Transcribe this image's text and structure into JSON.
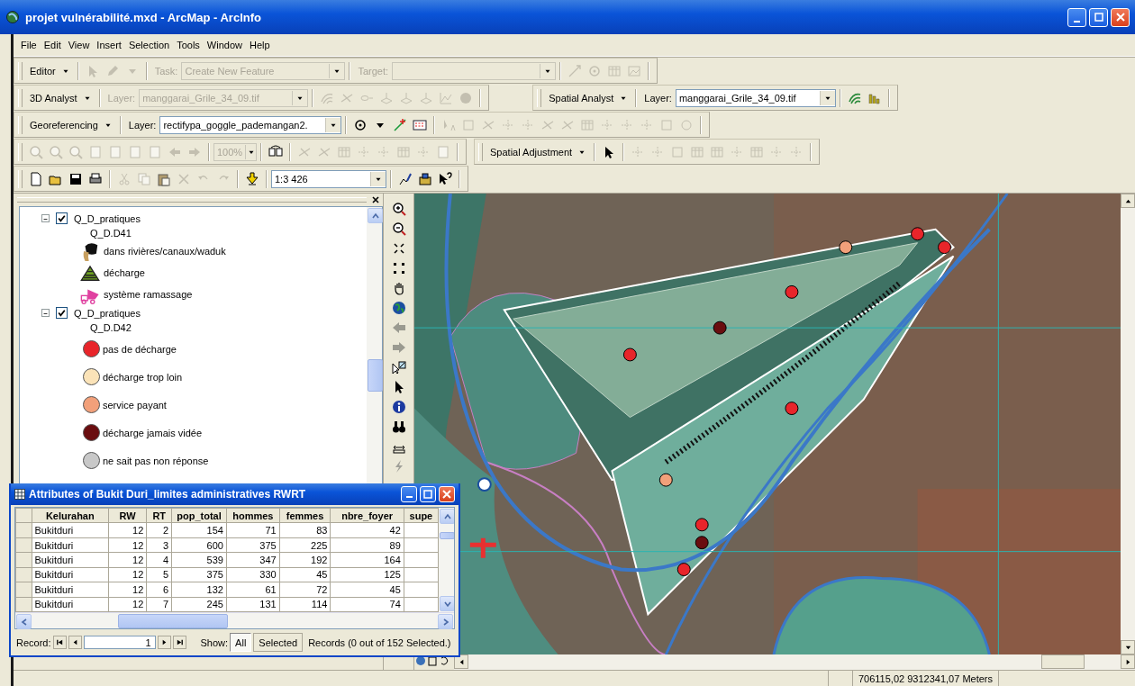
{
  "window": {
    "title": "projet vulnérabilité.mxd - ArcMap - ArcInfo"
  },
  "menu": [
    "File",
    "Edit",
    "View",
    "Insert",
    "Selection",
    "Tools",
    "Window",
    "Help"
  ],
  "toolbar_rows": [
    [
      {
        "kind": "editor",
        "items": [
          {
            "kind": "menu",
            "label": "Editor"
          },
          {
            "kind": "tools",
            "disabled": true
          },
          {
            "kind": "label",
            "label": "Task:",
            "disabled": true
          },
          {
            "kind": "combo",
            "value": "Create New Feature",
            "disabled": true
          },
          {
            "kind": "label",
            "label": "Target:",
            "disabled": true
          },
          {
            "kind": "combo",
            "value": "",
            "disabled": true
          },
          {
            "kind": "tools",
            "disabled": true
          }
        ]
      }
    ],
    [
      {
        "kind": "analyst3d",
        "items": [
          {
            "kind": "menu",
            "label": "3D Analyst"
          },
          {
            "kind": "label",
            "label": "Layer:",
            "disabled": true
          },
          {
            "kind": "combo",
            "value": "manggarai_Grile_34_09.tif",
            "disabled": true
          },
          {
            "kind": "tools",
            "disabled": true
          }
        ]
      },
      {
        "kind": "spatial",
        "items": [
          {
            "kind": "menu",
            "label": "Spatial Analyst"
          },
          {
            "kind": "label",
            "label": "Layer:",
            "disabled": false
          },
          {
            "kind": "combo",
            "value": "manggarai_Grile_34_09.tif",
            "disabled": false
          },
          {
            "kind": "tools",
            "disabled": false
          }
        ]
      }
    ],
    [
      {
        "kind": "georef",
        "items": [
          {
            "kind": "menu",
            "label": "Georeferencing"
          },
          {
            "kind": "label",
            "label": "Layer:",
            "disabled": false
          },
          {
            "kind": "combo",
            "value": "rectifypa_goggle_pademangan2.",
            "disabled": false
          },
          {
            "kind": "tools",
            "disabled": false
          },
          {
            "kind": "tools",
            "disabled": true
          }
        ]
      }
    ],
    [
      {
        "kind": "layout",
        "items": [
          {
            "kind": "tools",
            "disabled": true
          },
          {
            "kind": "combo",
            "value": "100%",
            "disabled": true
          },
          {
            "kind": "tools",
            "disabled": false
          },
          {
            "kind": "tools",
            "disabled": true
          }
        ]
      },
      {
        "kind": "adjust",
        "items": [
          {
            "kind": "menu",
            "label": "Spatial Adjustment"
          },
          {
            "kind": "tools",
            "disabled": false
          },
          {
            "kind": "tools",
            "disabled": true
          }
        ]
      }
    ],
    [
      {
        "kind": "standard",
        "items": [
          {
            "kind": "tools",
            "disabled": false
          },
          {
            "kind": "tools",
            "disabled": true
          },
          {
            "kind": "tools",
            "disabled": false
          },
          {
            "kind": "combo",
            "value": "1:3 426",
            "disabled": false
          },
          {
            "kind": "tools",
            "disabled": false
          }
        ]
      }
    ]
  ],
  "toc": {
    "layers": [
      {
        "name": "Q_D_pratiques",
        "checked": true,
        "expanded": true,
        "field": "Q_D.D41",
        "legend": [
          {
            "kind": "symbol",
            "label": "dans rivières/canaux/waduk"
          },
          {
            "kind": "symbol",
            "label": "décharge"
          },
          {
            "kind": "symbol",
            "label": "système ramassage"
          }
        ]
      },
      {
        "name": "Q_D_pratiques",
        "checked": true,
        "expanded": true,
        "field": "Q_D.D42",
        "legend": [
          {
            "kind": "dot",
            "label": "pas de décharge",
            "color": "#e8252a"
          },
          {
            "kind": "dot",
            "label": "décharge trop loin",
            "color": "#fbe3b8"
          },
          {
            "kind": "dot",
            "label": "service payant",
            "color": "#f2a07a"
          },
          {
            "kind": "dot",
            "label": "décharge jamais vidée",
            "color": "#6a0d0f"
          },
          {
            "kind": "dot",
            "label": "ne sait pas non réponse",
            "color": "#c8c8c8"
          }
        ]
      }
    ]
  },
  "attributes": {
    "title": "Attributes of Bukit Duri_limites administratives RWRT",
    "columns": [
      "Kelurahan",
      "RW",
      "RT",
      "pop_total",
      "hommes",
      "femmes",
      "nbre_foyer",
      "supe"
    ],
    "rows": [
      [
        "Bukitduri",
        "12",
        "2",
        "154",
        "71",
        "83",
        "42"
      ],
      [
        "Bukitduri",
        "12",
        "3",
        "600",
        "375",
        "225",
        "89"
      ],
      [
        "Bukitduri",
        "12",
        "4",
        "539",
        "347",
        "192",
        "164"
      ],
      [
        "Bukitduri",
        "12",
        "5",
        "375",
        "330",
        "45",
        "125"
      ],
      [
        "Bukitduri",
        "12",
        "6",
        "132",
        "61",
        "72",
        "45"
      ],
      [
        "Bukitduri",
        "12",
        "7",
        "245",
        "131",
        "114",
        "74"
      ]
    ],
    "record_label": "Record:",
    "record": "1",
    "show_label": "Show:",
    "show": [
      {
        "label": "All",
        "selected": true
      },
      {
        "label": "Selected",
        "selected": false
      }
    ],
    "records": "Records  (0 out of 152 Selected.)"
  },
  "status_bar": {
    "coordinates": "706115,02  9312341,07 Meters"
  }
}
